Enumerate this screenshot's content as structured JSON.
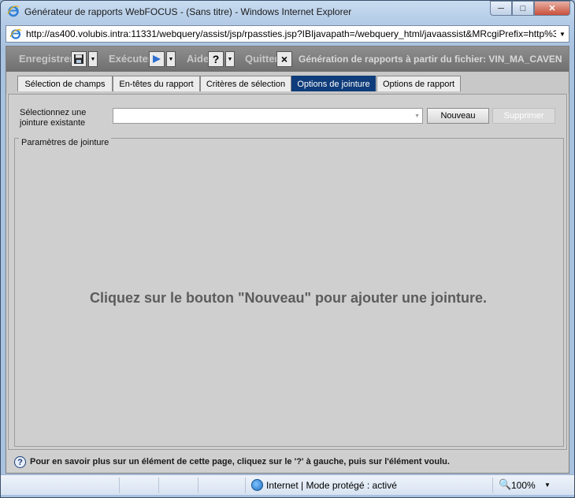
{
  "window": {
    "title": "Générateur de rapports WebFOCUS - (Sans titre) - Windows Internet Explorer",
    "address": "http://as400.volubis.intra:11331/webquery/assist/jsp/rpassties.jsp?IBIjavapath=/webquery_html/javaassist&MRcgiPrefix=http%3"
  },
  "toolbar": {
    "save_label": "Enregistrer",
    "run_label": "Exécuter",
    "help_label": "Aide",
    "quit_label": "Quitter",
    "help_glyph": "?",
    "quit_glyph": "×",
    "generation_text": "Génération de rapports à partir du fichier: VIN_MA_CAVEN"
  },
  "tabs": [
    {
      "label": "Sélection de champs",
      "active": false
    },
    {
      "label": "En-têtes du rapport",
      "active": false
    },
    {
      "label": "Critères de sélection",
      "active": false
    },
    {
      "label": "Options de jointure",
      "active": true
    },
    {
      "label": "Options de rapport",
      "active": false
    }
  ],
  "join": {
    "select_label_line1": "Sélectionnez une",
    "select_label_line2": "jointure existante",
    "select_value": "",
    "new_button": "Nouveau",
    "delete_button": "Supprimer",
    "params_legend": "Paramètres de jointure",
    "hint": "Cliquez sur le bouton \"Nouveau\" pour ajouter une jointure."
  },
  "help_line": "Pour en savoir plus sur un élément de cette page, cliquez sur le '?' à gauche, puis sur l'élément voulu.",
  "status": {
    "zone": "Internet | Mode protégé : activé",
    "zoom": "100%"
  },
  "colors": {
    "active_tab": "#0f3c7a",
    "toolbar_bg": "#7f7f7f",
    "panel_bg": "#cfcfcf"
  }
}
